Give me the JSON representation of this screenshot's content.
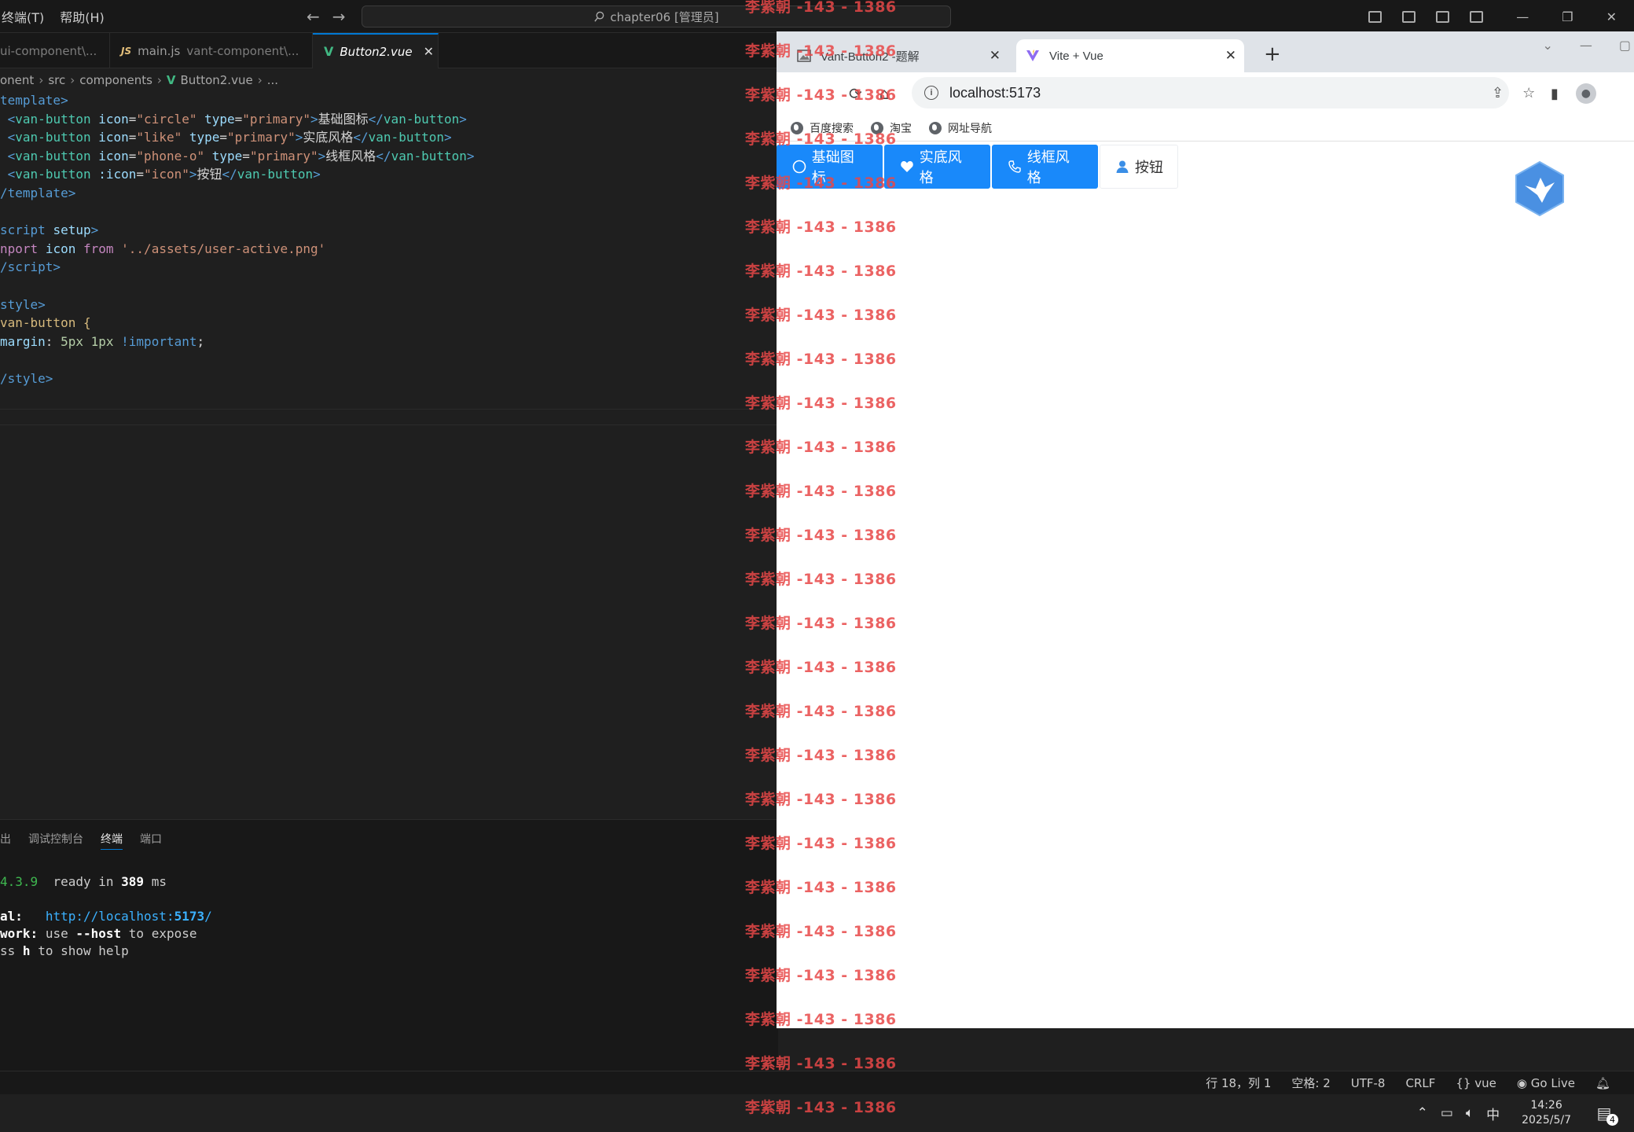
{
  "vscode": {
    "menu": [
      "终端(T)",
      "帮助(H)"
    ],
    "command_center": "chapter06 [管理员]",
    "tabs": [
      {
        "name": "ui-component\\..."
      },
      {
        "name": "main.js",
        "path": "vant-component\\..."
      },
      {
        "name": "Button2.vue"
      }
    ],
    "breadcrumb": [
      "onent",
      "src",
      "components",
      "Button2.vue",
      "..."
    ],
    "panel_tabs": [
      "出",
      "调试控制台",
      "终端",
      "端口"
    ],
    "terminal": {
      "line1_version": "4.3.9",
      "line1_text": "ready in",
      "line1_ms": "389",
      "line1_unit": "ms",
      "line2_label": "al:",
      "line2_url": "http://localhost:",
      "line2_port": "5173",
      "line2_slash": "/",
      "line3_label": "work:",
      "line3_text1": "use",
      "line3_flag": "--host",
      "line3_text2": "to expose",
      "line4_text1": "ss",
      "line4_key": "h",
      "line4_text2": "to show help"
    },
    "status": {
      "position": "行 18，列 1",
      "spaces": "空格: 2",
      "encoding": "UTF-8",
      "eol": "CRLF",
      "language": "vue",
      "golive": "Go Live"
    }
  },
  "taskbar": {
    "ime": "中",
    "time": "14:26",
    "date": "2025/5/7",
    "notifications": "4"
  },
  "browser": {
    "tabs": [
      {
        "title": "Vant-Button2 -题解"
      },
      {
        "title": "Vite + Vue"
      }
    ],
    "url": "localhost:5173",
    "bookmarks": [
      "百度搜索",
      "淘宝",
      "网址导航"
    ],
    "buttons": [
      {
        "label": "基础图标",
        "type": "primary",
        "icon": "circle-icon"
      },
      {
        "label": "实底风格",
        "type": "primary",
        "icon": "like-icon"
      },
      {
        "label": "线框风格",
        "type": "primary",
        "icon": "phone-icon"
      },
      {
        "label": "按钮",
        "type": "default",
        "icon": "user-icon"
      }
    ],
    "colors": {
      "primary": "#1989fa"
    }
  },
  "watermark": "李紫朝 -143 - 1386"
}
